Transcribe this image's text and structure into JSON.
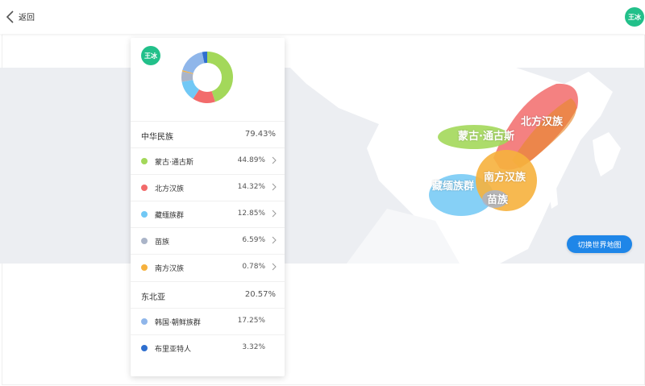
{
  "header": {
    "back_label": "返回",
    "avatar_text": "王冰"
  },
  "panel": {
    "avatar_text": "王冰"
  },
  "chart_data": {
    "type": "pie",
    "series": [
      {
        "name": "蒙古·通古斯",
        "value": 44.89,
        "color": "#a3d85a"
      },
      {
        "name": "北方汉族",
        "value": 14.32,
        "color": "#f26b6b"
      },
      {
        "name": "藏缅族群",
        "value": 12.85,
        "color": "#71c8f5"
      },
      {
        "name": "苗族",
        "value": 6.59,
        "color": "#aab4c8"
      },
      {
        "name": "南方汉族",
        "value": 0.78,
        "color": "#f6b13d"
      },
      {
        "name": "韩国·朝鲜族群",
        "value": 17.25,
        "color": "#8fb6ea"
      },
      {
        "name": "布里亚特人",
        "value": 3.32,
        "color": "#2f6fcf"
      }
    ]
  },
  "groups": [
    {
      "label": "中华民族",
      "pct": "79.43%"
    },
    {
      "label": "东北亚",
      "pct": "20.57%"
    }
  ],
  "items": [
    {
      "label": "蒙古·通古斯",
      "pct": "44.89%",
      "color": "#a3d85a"
    },
    {
      "label": "北方汉族",
      "pct": "14.32%",
      "color": "#f26b6b"
    },
    {
      "label": "藏缅族群",
      "pct": "12.85%",
      "color": "#71c8f5"
    },
    {
      "label": "苗族",
      "pct": "6.59%",
      "color": "#aab4c8"
    },
    {
      "label": "南方汉族",
      "pct": "0.78%",
      "color": "#f6b13d"
    },
    {
      "label": "韩国·朝鲜族群",
      "pct": "17.25%",
      "color": "#8fb6ea"
    },
    {
      "label": "布里亚特人",
      "pct": "3.32%",
      "color": "#2f6fcf"
    }
  ],
  "map": {
    "labels": [
      "蒙古·通古斯",
      "北方汉族",
      "藏缅族群",
      "南方汉族",
      "苗族"
    ],
    "switch_button": "切换世界地图"
  }
}
